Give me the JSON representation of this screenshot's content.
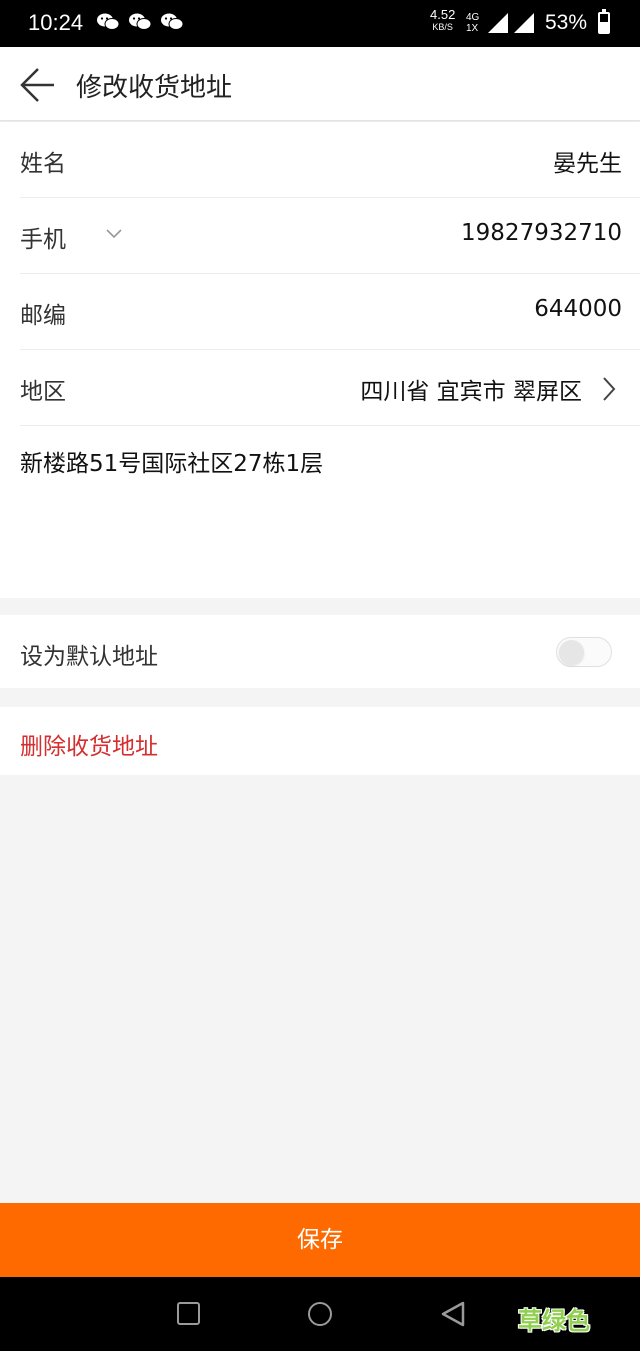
{
  "status_bar": {
    "time": "10:24",
    "speed_value": "4.52",
    "speed_unit": "KB/S",
    "network_top": "4G",
    "network_bottom": "1X",
    "battery_percent": "53%",
    "battery_level": 0.53,
    "notification_icons": [
      "wechat-icon",
      "wechat-icon",
      "wechat-icon"
    ]
  },
  "header": {
    "title": "修改收货地址",
    "back_icon": "arrow-left-icon"
  },
  "form": {
    "name_label": "姓名",
    "name_value": "晏先生",
    "phone_label": "手机",
    "phone_value": "19827932710",
    "postcode_label": "邮编",
    "postcode_value": "644000",
    "region_label": "地区",
    "region_value": "四川省 宜宾市 翠屏区",
    "address_detail": "新楼路51号国际社区27栋1层"
  },
  "default_address": {
    "label": "设为默认地址",
    "enabled": false
  },
  "delete": {
    "label": "删除收货地址"
  },
  "save": {
    "label": "保存"
  },
  "watermark": {
    "text": "草绿色"
  },
  "colors": {
    "accent": "#ff6a00",
    "danger": "#d32f2f",
    "background": "#f4f4f4",
    "watermark": "#8fd14f"
  }
}
